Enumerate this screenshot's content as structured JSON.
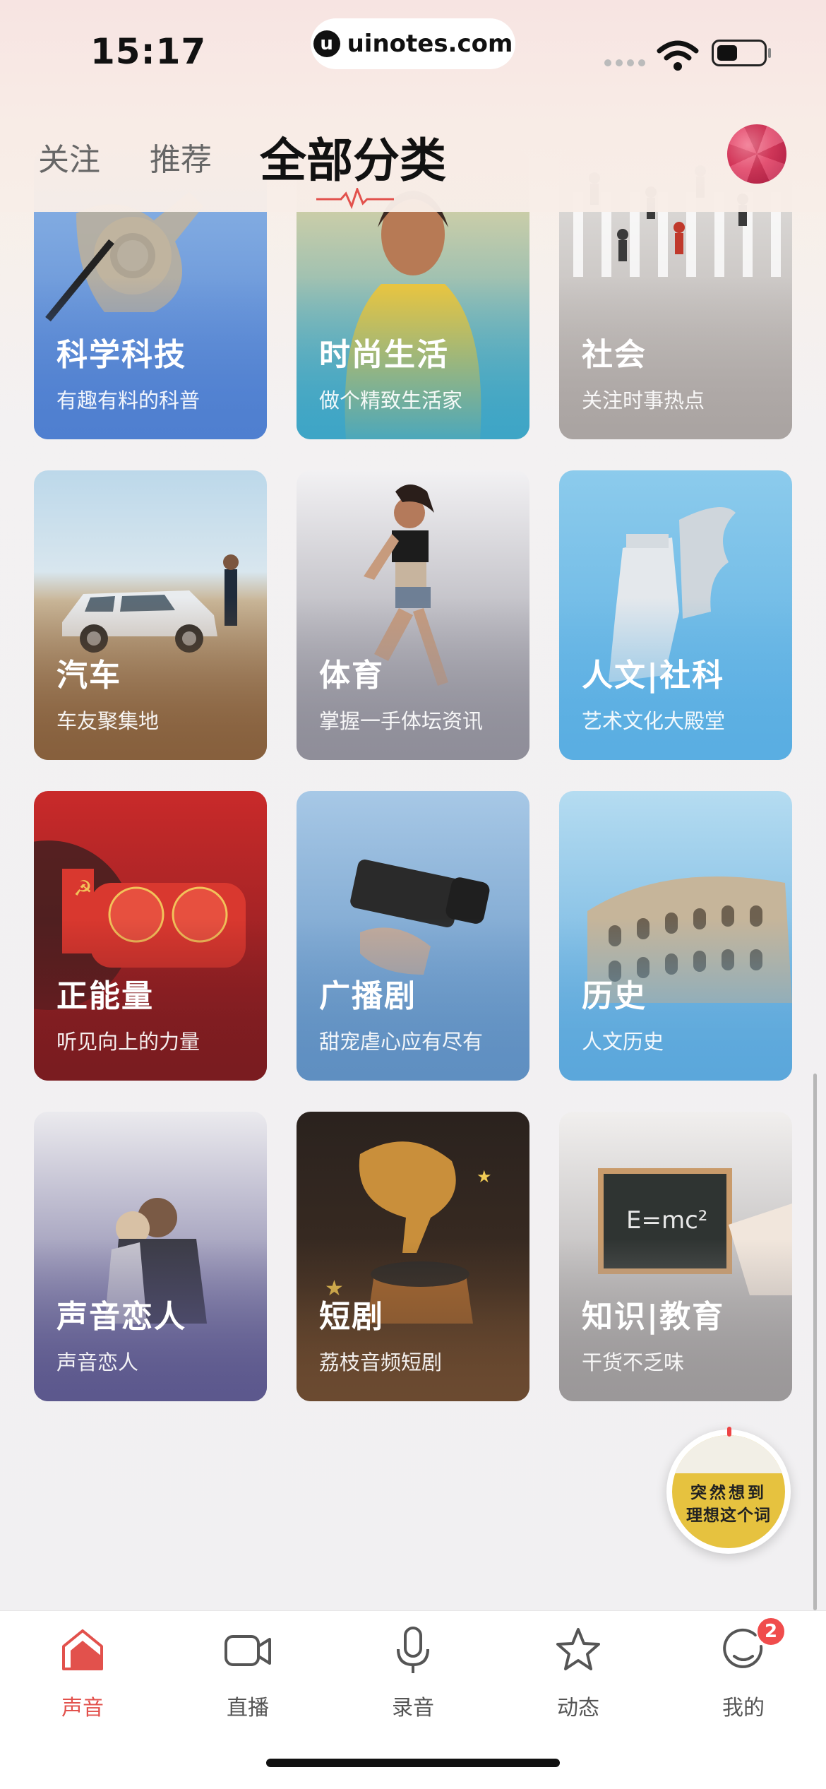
{
  "status_bar": {
    "time": "15:17",
    "url": "uinotes.com",
    "url_icon": "u"
  },
  "top_nav": {
    "tabs": [
      {
        "label": "关注",
        "active": false
      },
      {
        "label": "推荐",
        "active": false
      },
      {
        "label": "全部分类",
        "active": true
      }
    ],
    "accent_color": "#e2514c"
  },
  "categories": [
    {
      "title": "科学科技",
      "subtitle": "有趣有料的科普",
      "color_top": "#8fb7e6",
      "color_bottom": "#4f7fd0"
    },
    {
      "title": "时尚生活",
      "subtitle": "做个精致生活家",
      "color_top": "#e7c24a",
      "color_bottom": "#3ea5c6"
    },
    {
      "title": "社会",
      "subtitle": "关注时事热点",
      "color_top": "#d9d7d6",
      "color_bottom": "#a9a3a1"
    },
    {
      "title": "汽车",
      "subtitle": "车友聚集地",
      "color_top": "#bcd8ea",
      "color_bottom": "#87603d"
    },
    {
      "title": "体育",
      "subtitle": "掌握一手体坛资讯",
      "color_top": "#f1f0f2",
      "color_bottom": "#8f8e99"
    },
    {
      "title": "人文|社科",
      "subtitle": "艺术文化大殿堂",
      "color_top": "#7ec2e8",
      "color_bottom": "#5aaee2"
    },
    {
      "title": "正能量",
      "subtitle": "听见向上的力量",
      "color_top": "#c92a2a",
      "color_bottom": "#7a1c20"
    },
    {
      "title": "广播剧",
      "subtitle": "甜宠虐心应有尽有",
      "color_top": "#9fc3e4",
      "color_bottom": "#5f8fc1"
    },
    {
      "title": "历史",
      "subtitle": "人文历史",
      "color_top": "#aad3ee",
      "color_bottom": "#5ba7db"
    },
    {
      "title": "声音恋人",
      "subtitle": "声音恋人",
      "color_top": "#e7e6ea",
      "color_bottom": "#5c588d"
    },
    {
      "title": "短剧",
      "subtitle": "荔枝音频短剧",
      "color_top": "#2c2420",
      "color_bottom": "#6b4a30"
    },
    {
      "title": "知识|教育",
      "subtitle": "干货不乏味",
      "color_top": "#f1efee",
      "color_bottom": "#9b9899"
    }
  ],
  "float_ad": {
    "line1": "突然想到",
    "line2": "理想这个词"
  },
  "tab_bar": {
    "items": [
      {
        "label": "声音",
        "icon": "house-icon",
        "active": true
      },
      {
        "label": "直播",
        "icon": "video-camera-icon",
        "active": false
      },
      {
        "label": "录音",
        "icon": "microphone-icon",
        "active": false
      },
      {
        "label": "动态",
        "icon": "star-icon",
        "active": false
      },
      {
        "label": "我的",
        "icon": "profile-icon",
        "active": false,
        "badge": "2"
      }
    ],
    "active_color": "#e2514c"
  }
}
